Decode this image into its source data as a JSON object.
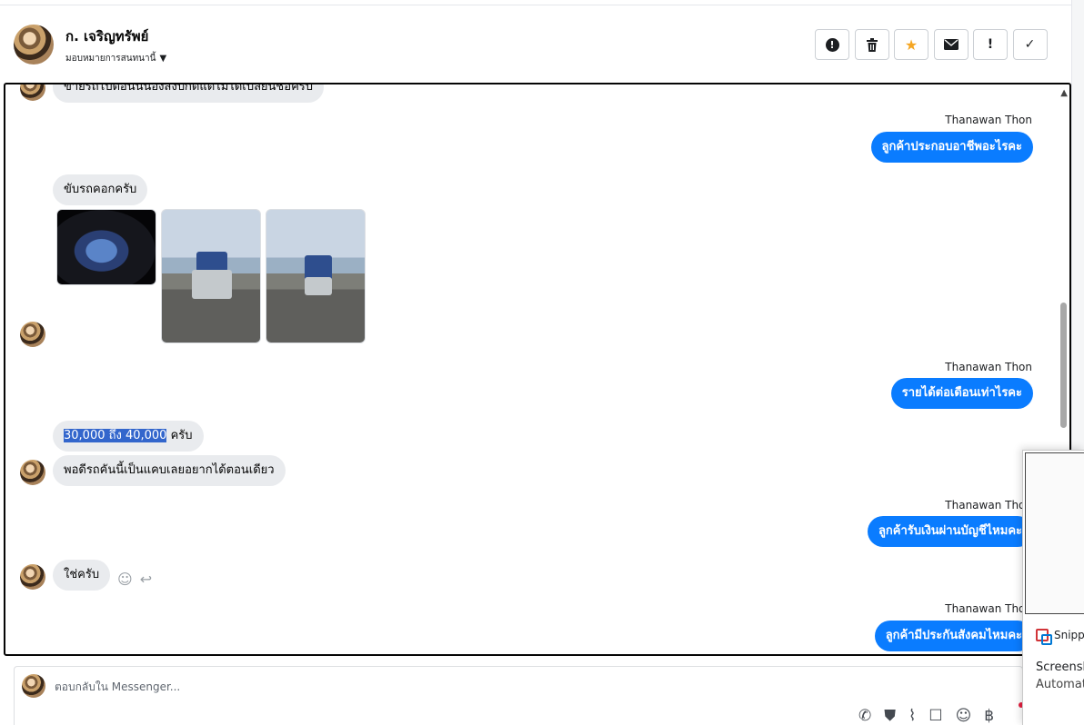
{
  "header": {
    "contact_name": "ก. เจริญทรัพย์",
    "assign_label": "มอบหมายการสนทนานี้",
    "actions": [
      {
        "name": "spam-icon",
        "glyph": "!"
      },
      {
        "name": "trash-icon",
        "glyph": "🗑"
      },
      {
        "name": "star-icon",
        "glyph": "★"
      },
      {
        "name": "envelope-icon",
        "glyph": "✉"
      },
      {
        "name": "exclamation-icon",
        "glyph": "!"
      },
      {
        "name": "checkmark-icon",
        "glyph": "✓"
      }
    ]
  },
  "messages": {
    "m0_in": "ขายรถไปตอนนี้น้องส่งปกติแต่ไม่ได้เปลี่ยนชื่อครับ",
    "m1_sender": "Thanawan Thon",
    "m1_out": "ลูกค้าประกอบอาชีพอะไรคะ",
    "m2_in": "ขับรถคอกครับ",
    "m3_sender": "Thanawan Thon",
    "m3_out": "รายได้ต่อเดือนเท่าไรคะ",
    "m4_in_highlight": "30,000 ถึง 40,000",
    "m4_in_rest": " ครับ",
    "m5_in": "พอดีรถคันนี้เป็นแคบเลยอยากได้ตอนเดียว",
    "m6_sender": "Thanawan Thon",
    "m6_out": "ลูกค้ารับเงินผ่านบัญชีไหมคะ",
    "m7_in": "ใช่ครับ",
    "m8_sender": "Thanawan Thon",
    "m8_out": "ลูกค้ามีประกันสังคมไหมคะ"
  },
  "composer": {
    "placeholder": "ตอบกลับใน Messenger..."
  },
  "snipping": {
    "app_name": "Snipp",
    "line1": "Screensh",
    "line2": "Automat"
  },
  "colors": {
    "outgoing_bubble": "#0a7cff",
    "incoming_bubble": "#e9ebee",
    "selection_highlight": "#3366cc",
    "star": "#f5a623"
  }
}
